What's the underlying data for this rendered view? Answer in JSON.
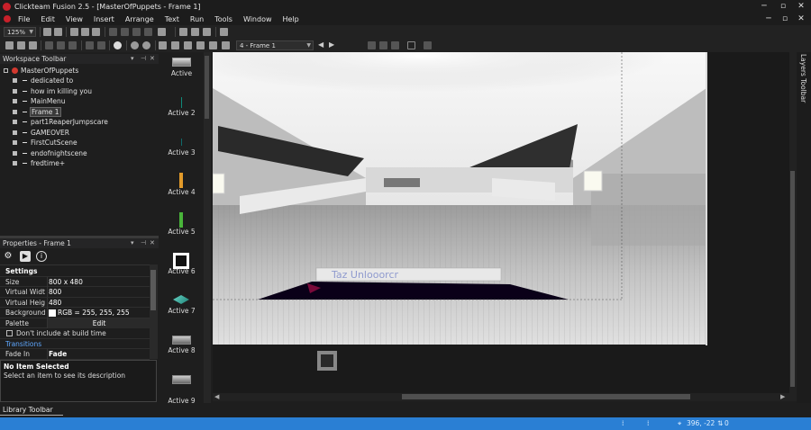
{
  "app": {
    "title": "Clickteam Fusion 2.5 - [MasterOfPuppets - Frame 1]",
    "accent": "#2a7fd4",
    "window_buttons": [
      "─",
      "▫",
      "✕"
    ],
    "mdi_buttons": [
      "─",
      "▫",
      "✕"
    ]
  },
  "menu": [
    "File",
    "Edit",
    "View",
    "Insert",
    "Arrange",
    "Text",
    "Run",
    "Tools",
    "Window",
    "Help"
  ],
  "toolbar": {
    "zoom": "125%",
    "frame_select": "4 - Frame 1"
  },
  "workspace": {
    "title": "Workspace Toolbar",
    "root": "MasterOfPuppets",
    "frames": [
      "dedicated to",
      "how im killing you",
      "MainMenu",
      "Frame 1",
      "part1ReaperJumpscare",
      "GAMEOVER",
      "FirstCutScene",
      "endofnightscene",
      "fredtime+"
    ],
    "selected": "Frame 1"
  },
  "properties": {
    "title": "Properties - Frame 1",
    "section_settings": "Settings",
    "rows": [
      {
        "name": "Size",
        "value": "800 x 480"
      },
      {
        "name": "Virtual Width",
        "value": "800"
      },
      {
        "name": "Virtual Height",
        "value": "480"
      },
      {
        "name": "Background c",
        "value": "RGB = 255, 255, 255"
      },
      {
        "name": "Palette",
        "value": "Edit"
      }
    ],
    "checkbox_label": "Don't include at build time",
    "section_transitions": "Transitions",
    "fade_in": {
      "name": "Fade In",
      "value": "Fade"
    }
  },
  "description": {
    "title": "No Item Selected",
    "text": "Select an item to see its description"
  },
  "library_tab": "Library Toolbar",
  "palette": [
    "Active",
    "Active 2",
    "Active 3",
    "Active 4",
    "Active 5",
    "Active 6",
    "Active 7",
    "Active 8",
    "Active 9"
  ],
  "layers_label": "Layers Toolbar",
  "status": {
    "coords": "396, -22",
    "objects": "0"
  }
}
